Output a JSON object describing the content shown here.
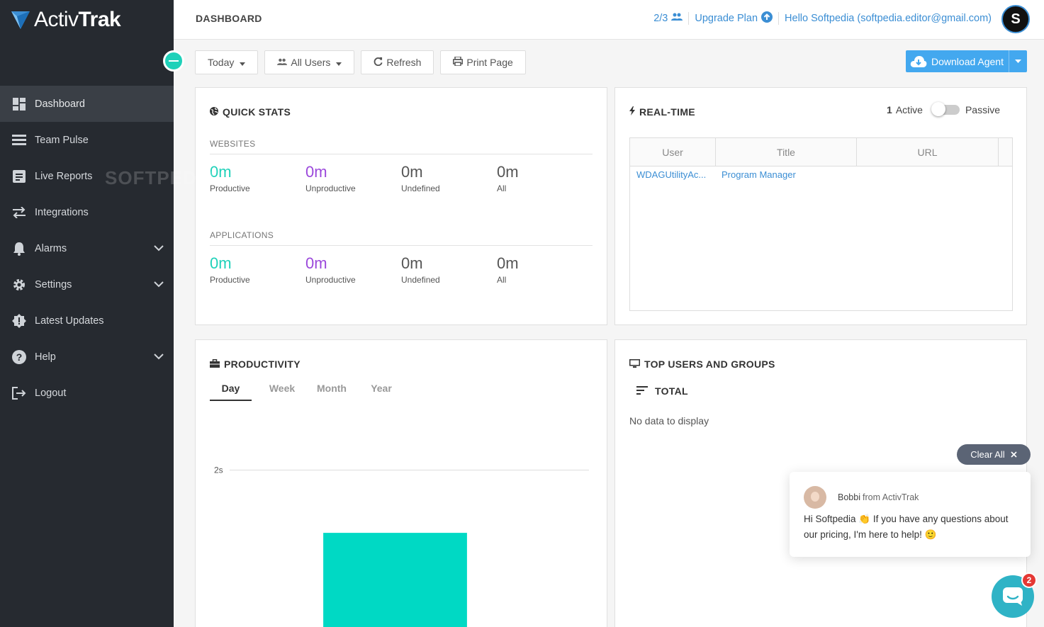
{
  "app": {
    "logo_prefix": "Activ",
    "logo_bold": "Trak",
    "watermark": "SOFTPEDIA"
  },
  "colors": {
    "sidebar_bg": "#262a30",
    "accent_teal": "#1fd1b9",
    "unproductive_purple": "#9b48db",
    "link_blue": "#3b8ed4",
    "download_blue": "#43a8ef"
  },
  "sidebar": {
    "items": [
      {
        "label": "Dashboard",
        "icon": "dashboard-icon",
        "active": true
      },
      {
        "label": "Team Pulse",
        "icon": "team-pulse-icon"
      },
      {
        "label": "Live Reports",
        "icon": "live-reports-icon"
      },
      {
        "label": "Integrations",
        "icon": "integrations-icon"
      },
      {
        "label": "Alarms",
        "icon": "bell-icon",
        "expandable": true
      },
      {
        "label": "Settings",
        "icon": "gear-icon",
        "expandable": true
      },
      {
        "label": "Latest Updates",
        "icon": "updates-badge-icon"
      },
      {
        "label": "Help",
        "icon": "help-icon",
        "expandable": true
      },
      {
        "label": "Logout",
        "icon": "logout-icon"
      }
    ]
  },
  "header": {
    "title": "DASHBOARD",
    "users_count": "2/3",
    "upgrade_label": "Upgrade Plan",
    "greeting": "Hello Softpedia (softpedia.editor@gmail.com)",
    "avatar_letter": "S"
  },
  "toolbar": {
    "date_label": "Today",
    "users_label": "All Users",
    "refresh_label": "Refresh",
    "print_label": "Print Page",
    "download_label": "Download Agent"
  },
  "quick_stats": {
    "title": "QUICK STATS",
    "websites": {
      "label": "WEBSITES",
      "cells": [
        {
          "value": "0m",
          "label": "Productive"
        },
        {
          "value": "0m",
          "label": "Unproductive"
        },
        {
          "value": "0m",
          "label": "Undefined"
        },
        {
          "value": "0m",
          "label": "All"
        }
      ]
    },
    "applications": {
      "label": "APPLICATIONS",
      "cells": [
        {
          "value": "0m",
          "label": "Productive"
        },
        {
          "value": "0m",
          "label": "Unproductive"
        },
        {
          "value": "0m",
          "label": "Undefined"
        },
        {
          "value": "0m",
          "label": "All"
        }
      ]
    }
  },
  "realtime": {
    "title": "REAL-TIME",
    "active_count": "1",
    "active_label": "Active",
    "passive_label": "Passive",
    "columns": [
      "User",
      "Title",
      "URL"
    ],
    "rows": [
      {
        "user": "WDAGUtilityAc...",
        "title": "Program Manager",
        "url": ""
      }
    ]
  },
  "productivity": {
    "title": "PRODUCTIVITY",
    "tabs": [
      "Day",
      "Week",
      "Month",
      "Year"
    ],
    "active_tab": "Day"
  },
  "chart_data": {
    "type": "bar",
    "categories": [
      ""
    ],
    "values": [
      2
    ],
    "ytick_labels": [
      "2s"
    ],
    "ylim": [
      0,
      2.7
    ],
    "grid": true,
    "bar_color": "#00d9c4"
  },
  "top_users": {
    "title": "TOP USERS AND GROUPS",
    "total_label": "TOTAL",
    "empty_text": "No data to display"
  },
  "chat": {
    "clear_all": "Clear All",
    "agent_name": "Bobbi",
    "agent_org": "from ActivTrak",
    "message": "Hi Softpedia 👏 If you have any questions about our pricing, I'm here to help! 🙂",
    "badge_count": "2"
  }
}
